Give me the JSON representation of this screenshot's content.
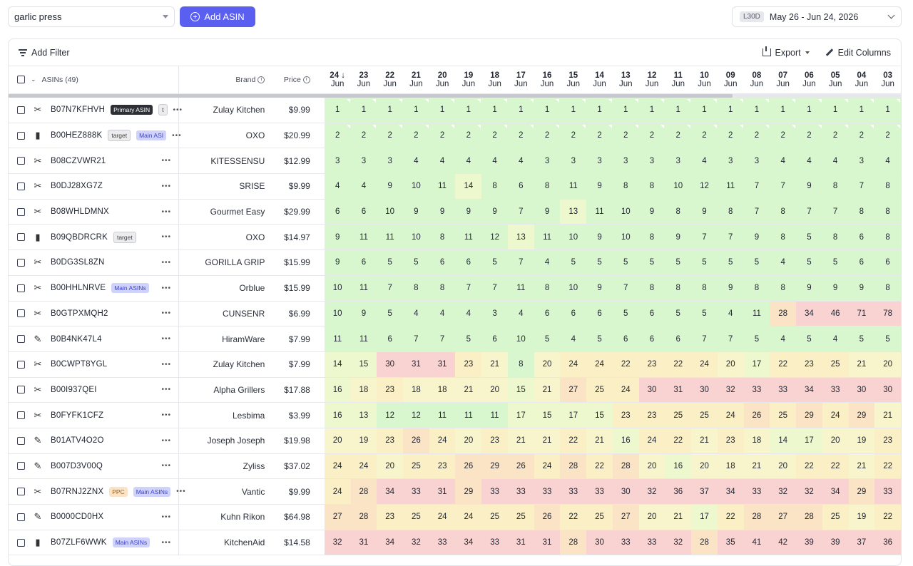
{
  "search": {
    "value": "garlic press"
  },
  "add_asin_label": "Add ASIN",
  "date": {
    "badge": "L30D",
    "range": "May 26 - Jun 24, 2026"
  },
  "toolbar": {
    "add_filter": "Add Filter",
    "export": "Export",
    "edit_columns": "Edit Columns"
  },
  "columns": {
    "asins": "ASINs (49)",
    "brand": "Brand",
    "price": "Price"
  },
  "days": [
    {
      "d": "24",
      "m": "Jun"
    },
    {
      "d": "23",
      "m": "Jun"
    },
    {
      "d": "22",
      "m": "Jun"
    },
    {
      "d": "21",
      "m": "Jun"
    },
    {
      "d": "20",
      "m": "Jun"
    },
    {
      "d": "19",
      "m": "Jun"
    },
    {
      "d": "18",
      "m": "Jun"
    },
    {
      "d": "17",
      "m": "Jun"
    },
    {
      "d": "16",
      "m": "Jun"
    },
    {
      "d": "15",
      "m": "Jun"
    },
    {
      "d": "14",
      "m": "Jun"
    },
    {
      "d": "13",
      "m": "Jun"
    },
    {
      "d": "12",
      "m": "Jun"
    },
    {
      "d": "11",
      "m": "Jun"
    },
    {
      "d": "10",
      "m": "Jun"
    },
    {
      "d": "09",
      "m": "Jun"
    },
    {
      "d": "08",
      "m": "Jun"
    },
    {
      "d": "07",
      "m": "Jun"
    },
    {
      "d": "06",
      "m": "Jun"
    },
    {
      "d": "05",
      "m": "Jun"
    },
    {
      "d": "04",
      "m": "Jun"
    },
    {
      "d": "03",
      "m": "Jun"
    }
  ],
  "rows": [
    {
      "asin": "B07N7KFHVH",
      "tags": [
        {
          "t": "Primary ASIN",
          "k": "primary"
        },
        {
          "t": "t",
          "k": "target"
        }
      ],
      "icon": "✂",
      "brand": "Zulay Kitchen",
      "price": "$9.99",
      "ranks": [
        1,
        1,
        1,
        1,
        1,
        1,
        1,
        1,
        1,
        1,
        1,
        1,
        1,
        1,
        1,
        1,
        1,
        1,
        1,
        1,
        1,
        1
      ]
    },
    {
      "asin": "B00HEZ888K",
      "tags": [
        {
          "t": "target",
          "k": "target"
        },
        {
          "t": "Main ASI",
          "k": "main"
        }
      ],
      "icon": "▮",
      "brand": "OXO",
      "price": "$20.99",
      "ranks": [
        2,
        2,
        2,
        2,
        2,
        2,
        2,
        2,
        2,
        2,
        2,
        2,
        2,
        2,
        2,
        2,
        2,
        2,
        2,
        2,
        2,
        2
      ]
    },
    {
      "asin": "B08CZVWR21",
      "tags": [],
      "icon": "✂",
      "brand": "KITESSENSU",
      "price": "$12.99",
      "ranks": [
        3,
        3,
        3,
        4,
        4,
        4,
        4,
        4,
        3,
        3,
        3,
        3,
        3,
        3,
        4,
        3,
        3,
        4,
        4,
        4,
        3,
        4
      ]
    },
    {
      "asin": "B0DJ28XG7Z",
      "tags": [],
      "icon": "✂",
      "brand": "SRISE",
      "price": "$9.99",
      "ranks": [
        4,
        4,
        9,
        10,
        11,
        14,
        8,
        6,
        8,
        11,
        9,
        8,
        8,
        10,
        12,
        11,
        7,
        7,
        9,
        8,
        7,
        8
      ]
    },
    {
      "asin": "B08WHLDMNX",
      "tags": [],
      "icon": "✂",
      "brand": "Gourmet Easy",
      "price": "$29.99",
      "ranks": [
        6,
        6,
        10,
        9,
        9,
        9,
        9,
        7,
        9,
        13,
        11,
        10,
        9,
        8,
        9,
        8,
        7,
        8,
        7,
        7,
        8,
        8
      ]
    },
    {
      "asin": "B09QBDRCRK",
      "tags": [
        {
          "t": "target",
          "k": "target"
        }
      ],
      "icon": "▮",
      "brand": "OXO",
      "price": "$14.97",
      "ranks": [
        9,
        11,
        11,
        10,
        8,
        11,
        12,
        13,
        11,
        10,
        9,
        10,
        8,
        9,
        7,
        7,
        9,
        8,
        5,
        8,
        6,
        8
      ]
    },
    {
      "asin": "B0DG3SL8ZN",
      "tags": [],
      "icon": "✂",
      "brand": "GORILLA GRIP",
      "price": "$15.99",
      "ranks": [
        9,
        6,
        5,
        5,
        6,
        6,
        5,
        7,
        4,
        5,
        5,
        5,
        5,
        5,
        5,
        5,
        5,
        4,
        5,
        5,
        6,
        6
      ]
    },
    {
      "asin": "B00HHLNRVE",
      "tags": [
        {
          "t": "Main ASINs",
          "k": "main"
        }
      ],
      "icon": "✂",
      "brand": "Orblue",
      "price": "$15.99",
      "ranks": [
        10,
        11,
        7,
        8,
        8,
        7,
        7,
        11,
        8,
        10,
        9,
        7,
        8,
        8,
        8,
        9,
        8,
        8,
        9,
        9,
        9,
        8
      ]
    },
    {
      "asin": "B0GTPXMQH2",
      "tags": [],
      "icon": "✂",
      "brand": "CUNSENR",
      "price": "$6.99",
      "ranks": [
        10,
        9,
        5,
        4,
        4,
        4,
        3,
        4,
        6,
        6,
        6,
        5,
        6,
        5,
        5,
        4,
        11,
        28,
        34,
        46,
        71,
        78
      ]
    },
    {
      "asin": "B0B4NK47L4",
      "tags": [],
      "icon": "✎",
      "brand": "HiramWare",
      "price": "$7.99",
      "ranks": [
        11,
        11,
        6,
        7,
        7,
        5,
        6,
        10,
        5,
        4,
        5,
        6,
        6,
        6,
        7,
        7,
        5,
        4,
        5,
        4,
        5,
        5
      ]
    },
    {
      "asin": "B0CWPT8YGL",
      "tags": [],
      "icon": "✂",
      "brand": "Zulay Kitchen",
      "price": "$7.99",
      "ranks": [
        14,
        15,
        30,
        31,
        31,
        23,
        21,
        8,
        20,
        24,
        24,
        22,
        23,
        22,
        24,
        20,
        17,
        22,
        23,
        25,
        21,
        20
      ]
    },
    {
      "asin": "B00I937QEI",
      "tags": [],
      "icon": "✂",
      "brand": "Alpha Grillers",
      "price": "$17.88",
      "ranks": [
        16,
        18,
        23,
        18,
        18,
        21,
        20,
        15,
        21,
        27,
        25,
        24,
        30,
        31,
        30,
        32,
        33,
        33,
        34,
        33,
        30,
        30
      ]
    },
    {
      "asin": "B0FYFK1CFZ",
      "tags": [],
      "icon": "✂",
      "brand": "Lesbima",
      "price": "$3.99",
      "ranks": [
        16,
        13,
        12,
        12,
        11,
        11,
        11,
        17,
        15,
        17,
        15,
        23,
        23,
        25,
        25,
        24,
        26,
        25,
        29,
        24,
        29,
        21
      ]
    },
    {
      "asin": "B01ATV4O2O",
      "tags": [],
      "icon": "✎",
      "brand": "Joseph Joseph",
      "price": "$19.98",
      "ranks": [
        20,
        19,
        23,
        26,
        24,
        20,
        23,
        21,
        21,
        22,
        21,
        16,
        24,
        22,
        21,
        23,
        18,
        14,
        17,
        20,
        19,
        23
      ]
    },
    {
      "asin": "B007D3V00Q",
      "tags": [],
      "icon": "✎",
      "brand": "Zyliss",
      "price": "$37.02",
      "ranks": [
        24,
        24,
        20,
        25,
        23,
        26,
        29,
        26,
        24,
        28,
        22,
        28,
        20,
        16,
        20,
        18,
        21,
        20,
        22,
        22,
        21,
        22
      ]
    },
    {
      "asin": "B07RNJ2ZNX",
      "tags": [
        {
          "t": "PPC",
          "k": "ppc"
        },
        {
          "t": "Main ASINs",
          "k": "main"
        }
      ],
      "icon": "✂",
      "brand": "Vantic",
      "price": "$9.99",
      "ranks": [
        24,
        28,
        34,
        33,
        31,
        29,
        33,
        33,
        33,
        33,
        33,
        30,
        32,
        36,
        37,
        34,
        33,
        32,
        32,
        34,
        29,
        33
      ]
    },
    {
      "asin": "B0000CD0HX",
      "tags": [],
      "icon": "✎",
      "brand": "Kuhn Rikon",
      "price": "$64.98",
      "ranks": [
        27,
        28,
        23,
        25,
        24,
        24,
        25,
        25,
        26,
        22,
        25,
        27,
        20,
        21,
        17,
        22,
        28,
        27,
        28,
        25,
        19,
        22
      ]
    },
    {
      "asin": "B07ZLF6WWK",
      "tags": [
        {
          "t": "Main ASINs",
          "k": "main"
        }
      ],
      "icon": "▮",
      "brand": "KitchenAid",
      "price": "$14.58",
      "ranks": [
        32,
        31,
        34,
        32,
        33,
        34,
        33,
        31,
        31,
        28,
        30,
        33,
        33,
        32,
        28,
        35,
        41,
        42,
        39,
        39,
        37,
        36
      ]
    }
  ]
}
